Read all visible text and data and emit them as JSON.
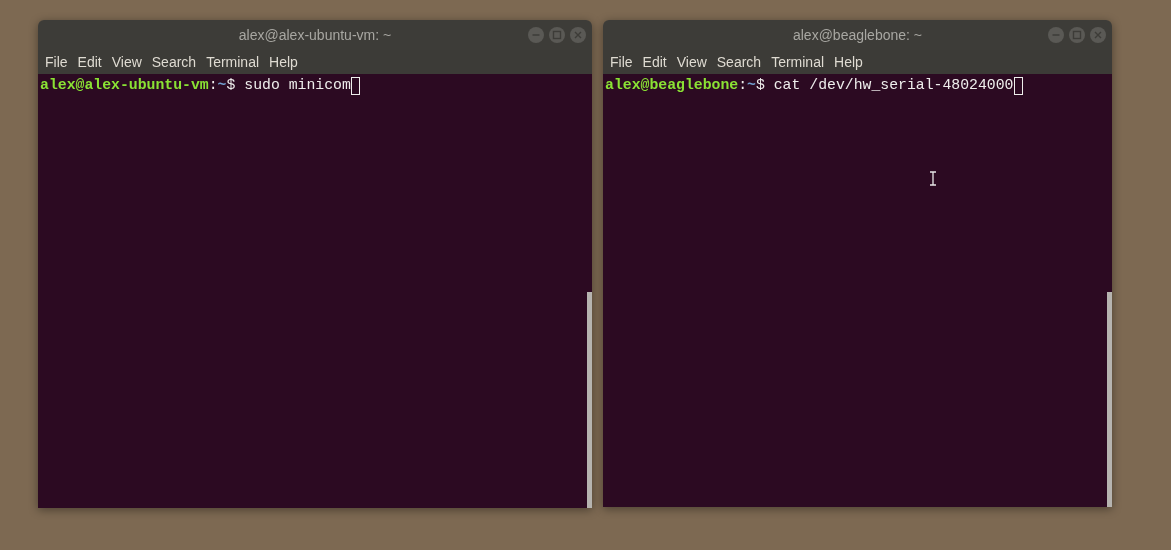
{
  "windows": [
    {
      "title": "alex@alex-ubuntu-vm: ~",
      "menu": [
        "File",
        "Edit",
        "View",
        "Search",
        "Terminal",
        "Help"
      ],
      "prompt": {
        "user_host": "alex@alex-ubuntu-vm",
        "separator": ":",
        "path": "~",
        "symbol": "$",
        "command": "sudo minicom"
      }
    },
    {
      "title": "alex@beaglebone: ~",
      "menu": [
        "File",
        "Edit",
        "View",
        "Search",
        "Terminal",
        "Help"
      ],
      "prompt": {
        "user_host": "alex@beaglebone",
        "separator": ":",
        "path": "~",
        "symbol": "$",
        "command": "cat /dev/hw_serial-48024000"
      }
    }
  ]
}
